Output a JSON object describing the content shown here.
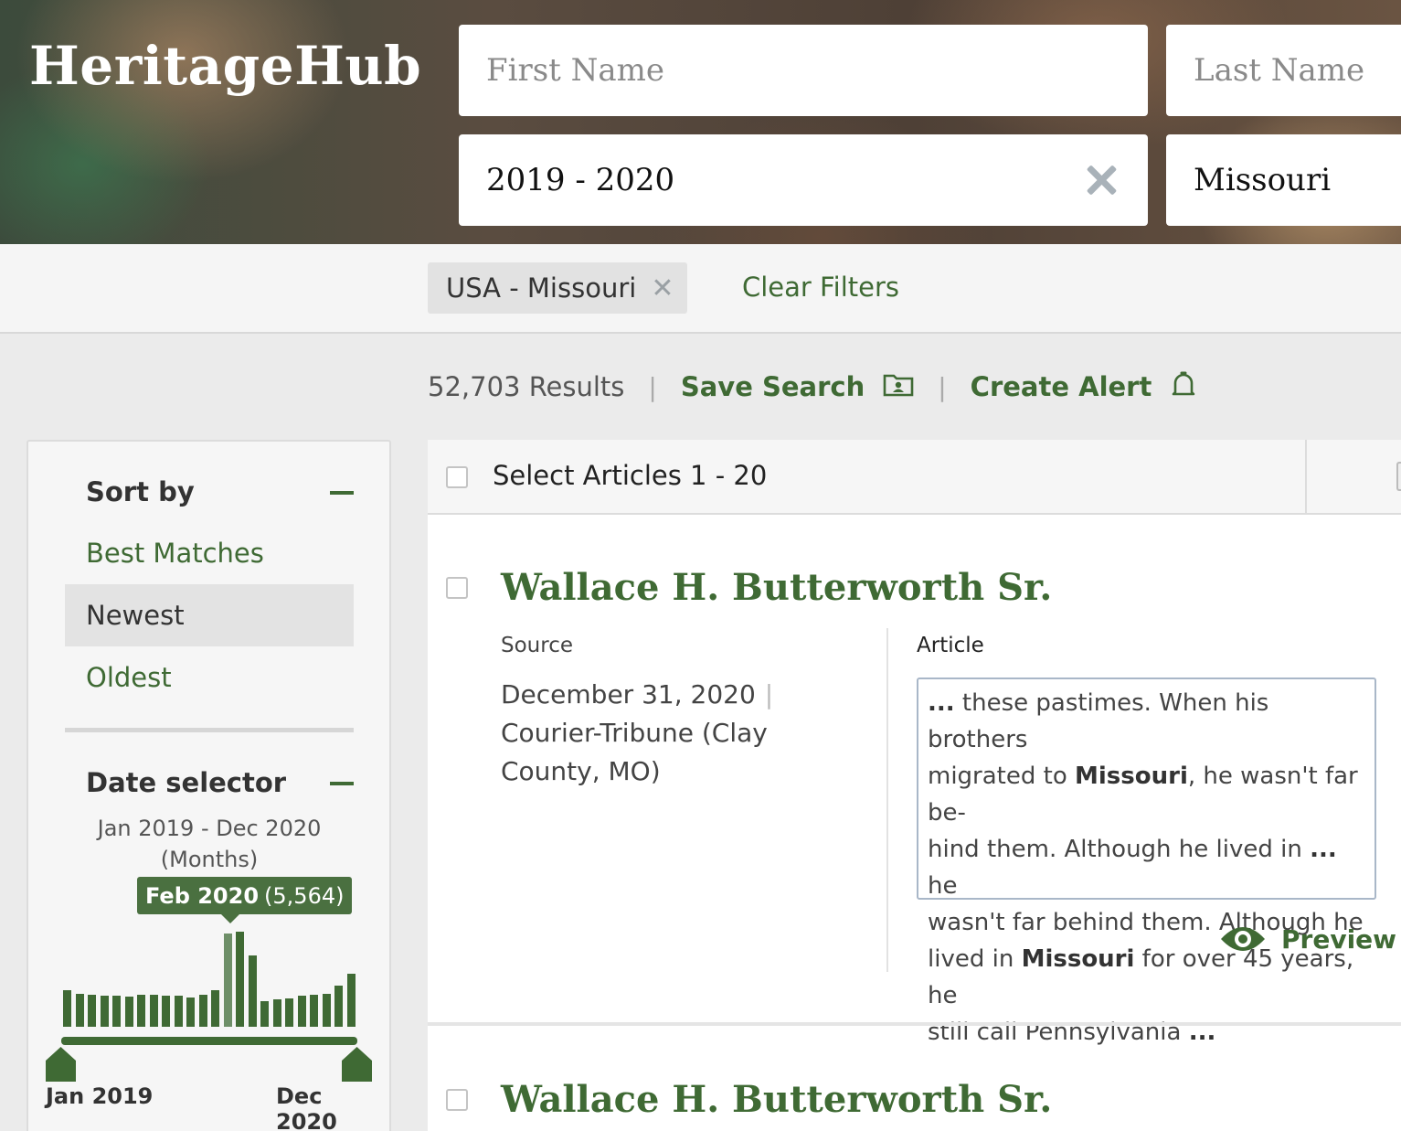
{
  "app": {
    "logo": "HeritageHub"
  },
  "search": {
    "first_name_placeholder": "First Name",
    "last_name_placeholder": "Last Name",
    "date_value": "2019 - 2020",
    "place_value": "Missouri"
  },
  "filters": {
    "chips": [
      {
        "label": "USA - Missouri"
      }
    ],
    "clear_label": "Clear Filters"
  },
  "results_bar": {
    "count": "52,703 Results",
    "save_search": "Save Search",
    "create_alert": "Create Alert"
  },
  "sidebar": {
    "sort_heading": "Sort by",
    "sort_options": [
      {
        "label": "Best Matches",
        "active": false
      },
      {
        "label": "Newest",
        "active": true
      },
      {
        "label": "Oldest",
        "active": false
      }
    ],
    "date_heading": "Date selector",
    "date_range": "Jan 2019 - Dec 2020",
    "date_unit": "(Months)",
    "tooltip_month": "Feb 2020",
    "tooltip_count": "(5,564)",
    "start_label": "Jan 2019",
    "end_label": "Dec 2020",
    "histogram_levels": [
      0.38,
      0.35,
      0.34,
      0.33,
      0.33,
      0.32,
      0.34,
      0.34,
      0.33,
      0.33,
      0.31,
      0.34,
      0.38,
      0.98,
      1.0,
      0.75,
      0.27,
      0.29,
      0.3,
      0.33,
      0.34,
      0.35,
      0.43,
      0.56
    ],
    "selected_index": 13
  },
  "results": {
    "select_label": "Select Articles 1 - 20",
    "source_label": "Source",
    "article_label": "Article",
    "preview_label": "Preview",
    "items": [
      {
        "title": "Wallace H. Butterworth Sr.",
        "date": "December 31, 2020",
        "publication": "Courier-Tribune (Clay County, MO)",
        "snippet_lines": [
          "... these pastimes. When his brothers",
          "migrated to Missouri, he wasn't far be-",
          "hind them. Although he lived in ... he",
          "wasn't far behind them. Although he",
          "lived in Missouri for over 45 years, he",
          "still call Pennsylvania ..."
        ]
      },
      {
        "title": "Wallace H. Butterworth Sr."
      }
    ]
  },
  "colors": {
    "brand_green": "#3f6a34",
    "selected_bar": "#6e8f68",
    "tooltip_bg": "#4a7040"
  }
}
